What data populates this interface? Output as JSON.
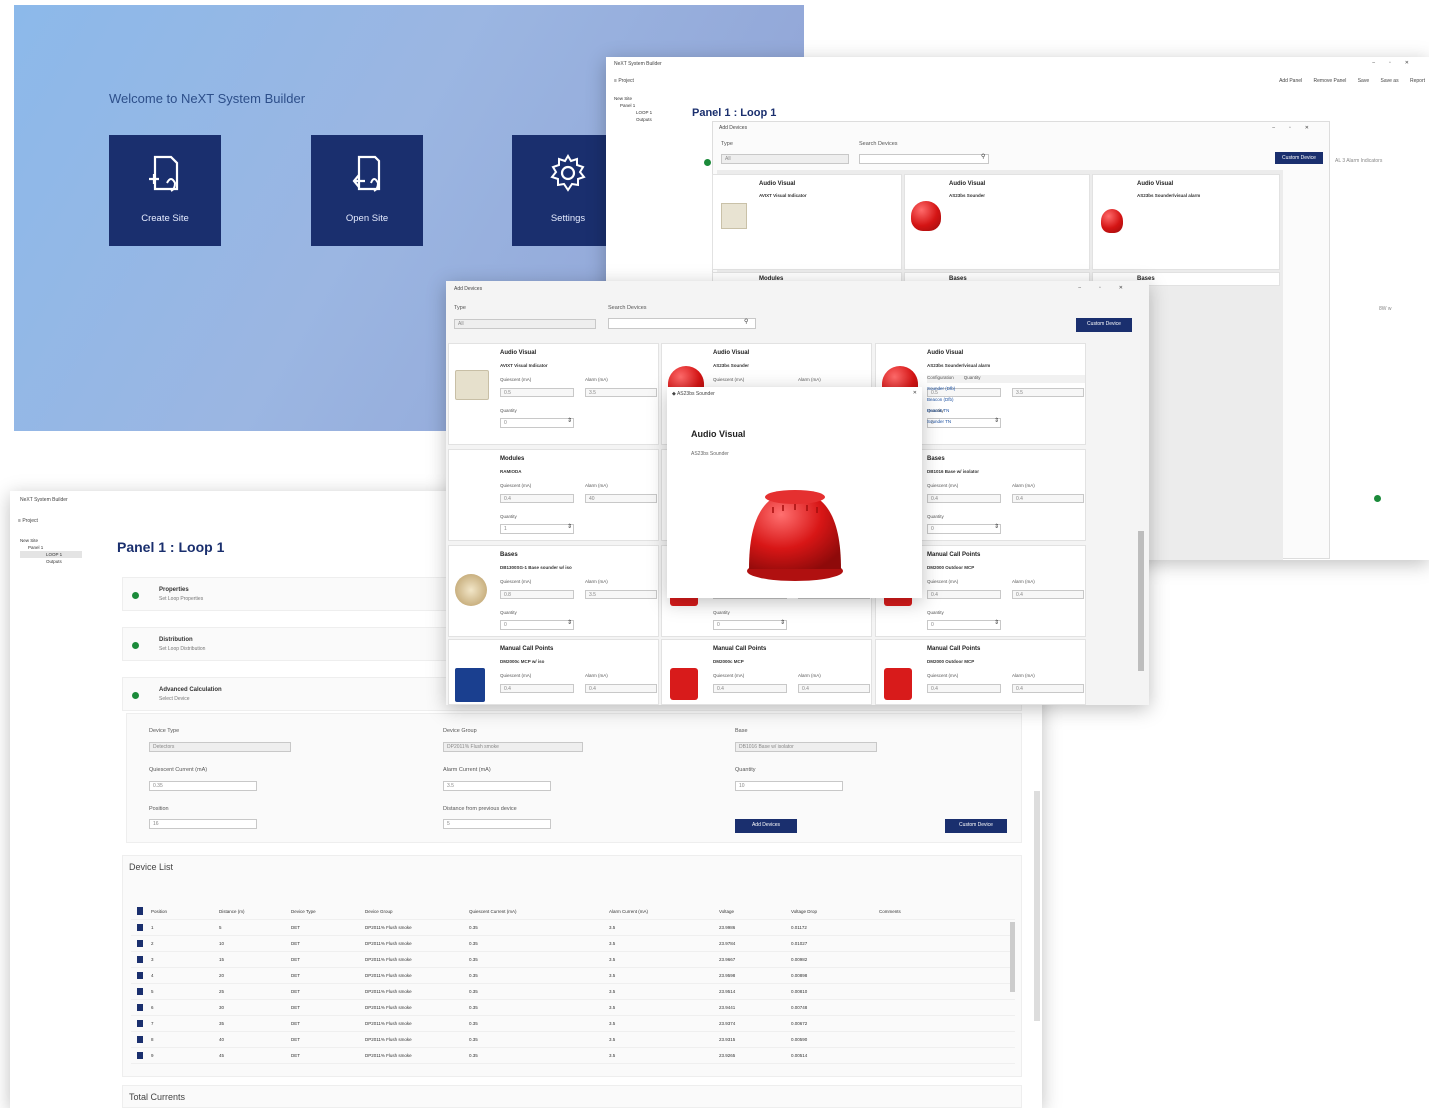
{
  "welcome": {
    "title": "Welcome to NeXT System Builder",
    "tiles": [
      {
        "label": "Create Site",
        "icon": "create-site-icon"
      },
      {
        "label": "Open Site",
        "icon": "open-site-icon"
      },
      {
        "label": "Settings",
        "icon": "gear-icon"
      }
    ]
  },
  "top_window": {
    "app_title": "NeXT System Builder",
    "menu": "Project",
    "toolbar": [
      "Add Panel",
      "Remove Panel",
      "Save",
      "Save as",
      "Report"
    ],
    "tree": [
      "New Site",
      "Panel 1",
      "LOOP 1",
      "Outputs"
    ],
    "page_title": "Panel 1 : Loop 1",
    "dialog_title": "Add Devices",
    "type_label": "Type",
    "type_value": "All",
    "search_label": "Search Devices",
    "custom_button": "Custom Device",
    "right_select": "AL 3 Alarm Indicators",
    "right_select2": "8W w"
  },
  "mid_window": {
    "title": "Add Devices",
    "type_label": "Type",
    "type_value": "All",
    "search_label": "Search Devices",
    "custom_button": "Custom Device",
    "labels": {
      "quiescent": "Quiescent (mA)",
      "alarm": "Alarm (mA)",
      "quantity": "Quantity",
      "configuration": "Configuration",
      "qty": "Quantity"
    },
    "cards": [
      {
        "cat": "Audio Visual",
        "name": "AVIXT Visual Indicator",
        "q": "0.5",
        "a": "3.5",
        "qty": "0"
      },
      {
        "cat": "Audio Visual",
        "name": "AS23bs Sounder",
        "q": "0.5",
        "a": "3.5",
        "qty": "0"
      },
      {
        "cat": "Audio Visual",
        "name": "AS23bs Sounder/visual alarm",
        "q": "0.5",
        "a": "3.5",
        "qty": "0"
      },
      {
        "cat": "Modules",
        "name": "RAMIODA",
        "q": "0.4",
        "a": "40",
        "qty": "1"
      },
      {
        "cat": "Audio Visual",
        "name": "AS23bs Sounder",
        "q": "",
        "a": "",
        "qty": "0"
      },
      {
        "cat": "Bases",
        "name": "DB1016 Base w/ isolator",
        "q": "0.4",
        "a": "0.4",
        "qty": "0"
      },
      {
        "cat": "Bases",
        "name": "DB1300SG-1 Base sounder w/ iso",
        "q": "0.8",
        "a": "3.5",
        "qty": "0"
      },
      {
        "cat": "Audio Visual",
        "name": "AS23bs Sounder",
        "q": "0.5",
        "a": "3.5",
        "qty": "0"
      },
      {
        "cat": "Manual Call Points",
        "name": "DM2000 Outdoor MCP",
        "q": "0.4",
        "a": "0.4",
        "qty": "0"
      },
      {
        "cat": "Manual Call Points",
        "name": "DM2000c MCP w/ iso",
        "q": "0.4",
        "a": "0.4",
        "qty": "0"
      },
      {
        "cat": "Manual Call Points",
        "name": "DM2000c MCP",
        "q": "0.4",
        "a": "0.4",
        "qty": "0"
      },
      {
        "cat": "Manual Call Points",
        "name": "DM2000 Outdoor MCP",
        "q": "0.4",
        "a": "0.4",
        "qty": "0"
      }
    ],
    "config_rows": [
      "Sounder (Dfb)",
      "Beacon (Dfb)",
      "Beacon TN",
      "Sounder TN"
    ],
    "popup": {
      "title": "AS23bs Sounder",
      "category": "Audio Visual",
      "name": "AS23bs Sounder"
    }
  },
  "bottom_window": {
    "app_title": "NeXT System Builder",
    "menu": "Project",
    "tree": [
      "New Site",
      "Panel 1",
      "LOOP 1",
      "Outputs"
    ],
    "page_title": "Panel 1 : Loop 1",
    "sections": [
      {
        "title": "Properties",
        "sub": "Set Loop Properties"
      },
      {
        "title": "Distribution",
        "sub": "Set Loop Distribution"
      },
      {
        "title": "Advanced Calculation",
        "sub": "Select Device"
      }
    ],
    "form": {
      "device_type_label": "Device Type",
      "device_type_value": "Detectors",
      "device_group_label": "Device Group",
      "device_group_value": "DP2011% Flush smoke",
      "base_label": "Base",
      "base_value": "DB1016 Base w/ isolator",
      "quiescent_label": "Quiescent Current (mA)",
      "quiescent_value": "0.35",
      "alarm_label": "Alarm Current (mA)",
      "alarm_value": "3.5",
      "quantity_label": "Quantity",
      "quantity_value": "10",
      "position_label": "Position",
      "position_value": "16",
      "distance_label": "Distance from previous device",
      "distance_value": "5",
      "add_button": "Add Devices",
      "custom_button": "Custom Device"
    },
    "device_list_title": "Device List",
    "columns": [
      "Position",
      "Distance (m)",
      "Device Type",
      "Device Group",
      "Quiescent Current (mA)",
      "Alarm Current (mA)",
      "Voltage",
      "Voltage Drop",
      "Comments"
    ],
    "rows": [
      [
        "1",
        "5",
        "DET",
        "DP2011% Flush smoke",
        "0.35",
        "3.5",
        "23.9986",
        "0.01172",
        ""
      ],
      [
        "2",
        "10",
        "DET",
        "DP2011% Flush smoke",
        "0.35",
        "3.5",
        "23.9784",
        "0.01027",
        ""
      ],
      [
        "3",
        "15",
        "DET",
        "DP2011% Flush smoke",
        "0.35",
        "3.5",
        "23.9667",
        "0.00982",
        ""
      ],
      [
        "4",
        "20",
        "DET",
        "DP2011% Flush smoke",
        "0.35",
        "3.5",
        "23.9598",
        "0.00898",
        ""
      ],
      [
        "5",
        "25",
        "DET",
        "DP2011% Flush smoke",
        "0.35",
        "3.5",
        "23.9514",
        "0.00810",
        ""
      ],
      [
        "6",
        "30",
        "DET",
        "DP2011% Flush smoke",
        "0.35",
        "3.5",
        "23.9441",
        "0.00748",
        ""
      ],
      [
        "7",
        "35",
        "DET",
        "DP2011% Flush smoke",
        "0.35",
        "3.5",
        "23.9374",
        "0.00672",
        ""
      ],
      [
        "8",
        "40",
        "DET",
        "DP2011% Flush smoke",
        "0.35",
        "3.5",
        "23.9315",
        "0.00590",
        ""
      ],
      [
        "9",
        "45",
        "DET",
        "DP2011% Flush smoke",
        "0.35",
        "3.5",
        "23.9265",
        "0.00514",
        ""
      ]
    ],
    "total_currents_title": "Total Currents"
  }
}
